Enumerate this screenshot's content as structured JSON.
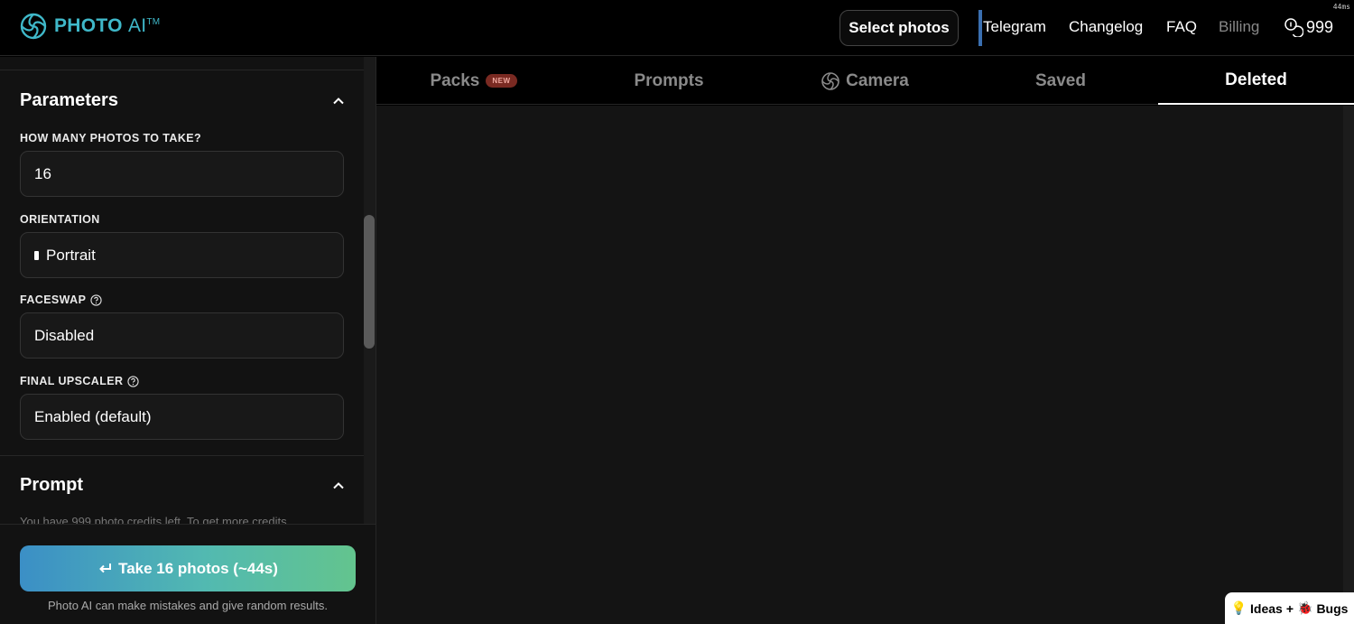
{
  "header": {
    "brand": "PHOTO",
    "brand_suffix": "AI",
    "trademark": "TM",
    "latency": "44ms",
    "select_photos": "Select photos",
    "nav": [
      "Telegram",
      "Changelog",
      "FAQ",
      "Billing"
    ],
    "credits": "999"
  },
  "sidebar": {
    "parameters": {
      "title": "Parameters",
      "fields": [
        {
          "label": "HOW MANY PHOTOS TO TAKE?",
          "value": "16"
        },
        {
          "label": "ORIENTATION",
          "value": "Portrait"
        },
        {
          "label": "FACESWAP",
          "value": "Disabled"
        },
        {
          "label": "FINAL UPSCALER",
          "value": "Enabled (default)"
        }
      ]
    },
    "prompt": {
      "title": "Prompt",
      "note": "You have 999 photo credits left. To get more credits"
    },
    "take_button": "Take 16 photos (~44s)",
    "disclaimer": "Photo AI can make mistakes and give random results."
  },
  "tabs": [
    {
      "label": "Packs",
      "badge": "NEW"
    },
    {
      "label": "Prompts"
    },
    {
      "label": "Camera"
    },
    {
      "label": "Saved"
    },
    {
      "label": "Deleted"
    }
  ],
  "active_tab": "Deleted",
  "feedback": {
    "ideas": "Ideas",
    "plus": "+",
    "bugs": "Bugs"
  },
  "colors": {
    "brand": "#3fb8c9",
    "nav_separator": "#3a6fb0",
    "gradient_start": "#3b8fc6",
    "gradient_end": "#63c48e"
  }
}
